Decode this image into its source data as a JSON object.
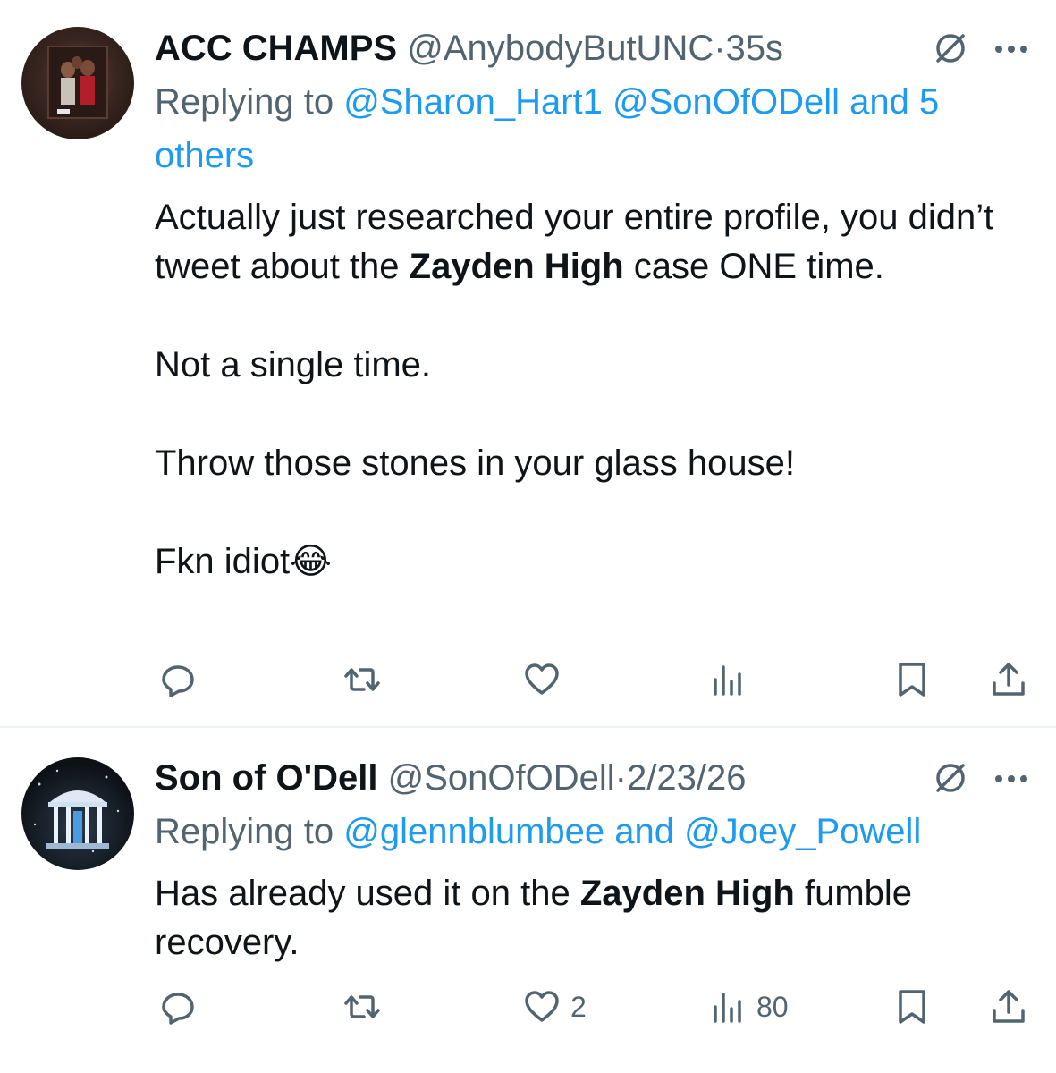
{
  "tweets": [
    {
      "name": "ACC CHAMPS",
      "handle": "@AnybodyButUNC",
      "dot": "·",
      "time": "35s",
      "replying_prefix": "Replying to ",
      "mentions_line": "@Sharon_Hart1 @SonOfODell and 5 others",
      "body": {
        "line1": "Actually just researched your entire profile, you didn’t tweet about the ",
        "bold": "Zayden High",
        "line1_end": " case ONE time.",
        "line2": "Not a single time.",
        "line3": "Throw those stones in your glass house!",
        "line4": "Fkn idiot😂"
      },
      "likes": "",
      "views": ""
    },
    {
      "name": "Son of O'Dell",
      "handle": "@SonOfODell",
      "dot": "·",
      "time": "2/23/26",
      "replying_prefix": "Replying to ",
      "mentions_line": "@glennblumbee and @Joey_Powell",
      "body": {
        "before": "Has already used it on the ",
        "bold": "Zayden High",
        "after": " fumble recovery."
      },
      "likes": "2",
      "views": "80"
    }
  ],
  "icons": {
    "reply": "reply-icon",
    "retweet": "retweet-icon",
    "like": "heart-icon",
    "views": "views-icon",
    "bookmark": "bookmark-icon",
    "share": "share-icon",
    "grok": "grok-icon",
    "more": "more-icon"
  },
  "colors": {
    "text": "#0f1419",
    "secondary": "#536471",
    "link": "#1d9bf0",
    "divider": "#eff3f4"
  }
}
